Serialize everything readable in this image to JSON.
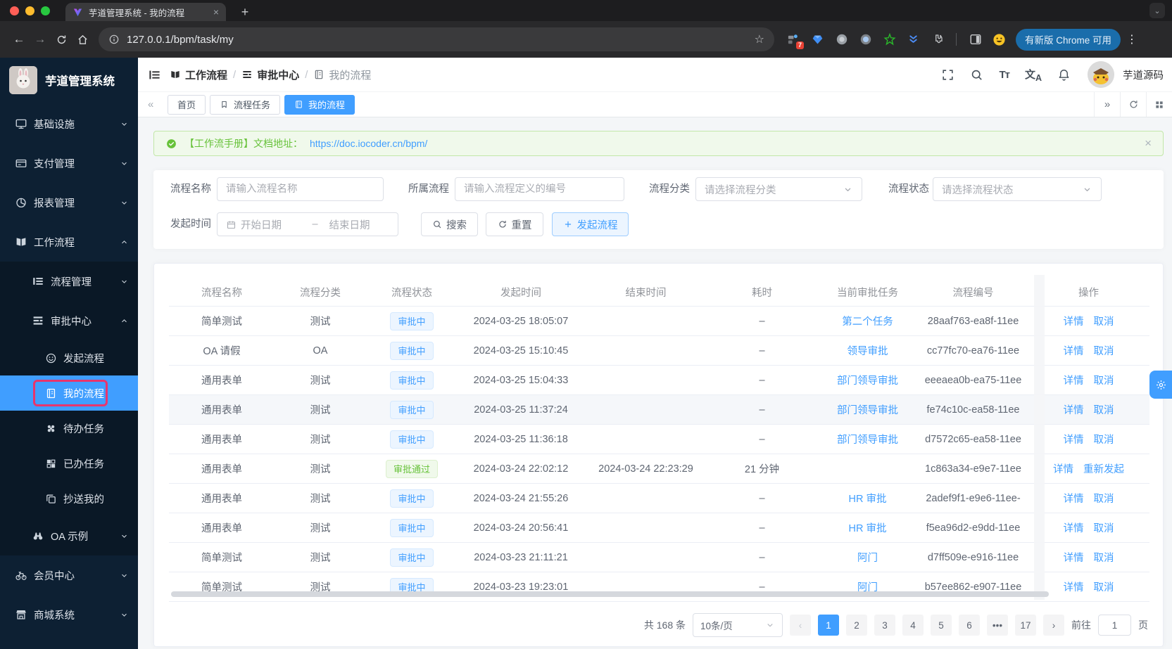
{
  "browser": {
    "tab_title": "芋道管理系统 - 我的流程",
    "url": "127.0.0.1/bpm/task/my",
    "extension_badge": "7",
    "update_chip": "有新版 Chrome 可用"
  },
  "glyphs": {
    "back": "←",
    "forward": "→",
    "new_tab": "+",
    "close": "×",
    "star": "☆",
    "kebab": "⋮",
    "collapse": "«",
    "expand": "»",
    "prev": "‹",
    "next": "›",
    "ellipsis": "•••",
    "dash": "–",
    "tab_search": "⌄"
  },
  "sidebar": {
    "logo_title": "芋道管理系统",
    "items": [
      {
        "label": "基础设施",
        "icon": "monitor-icon",
        "level": 1,
        "chevron": "down"
      },
      {
        "label": "支付管理",
        "icon": "payment-icon",
        "level": 1,
        "chevron": "down"
      },
      {
        "label": "报表管理",
        "icon": "pie-chart-icon",
        "level": 1,
        "chevron": "down"
      },
      {
        "label": "工作流程",
        "icon": "workflow-icon",
        "level": 1,
        "chevron": "up"
      },
      {
        "label": "流程管理",
        "icon": "process-manage-icon",
        "level": 2,
        "chevron": "down",
        "in_submenu": true
      },
      {
        "label": "审批中心",
        "icon": "approval-center-icon",
        "level": 2,
        "chevron": "up",
        "in_submenu": true
      },
      {
        "label": "发起流程",
        "icon": "smiley-icon",
        "level": 3,
        "in_submenu": true
      },
      {
        "label": "我的流程",
        "icon": "notebook-icon",
        "level": 3,
        "in_submenu": true,
        "active": true,
        "annotated": true
      },
      {
        "label": "待办任务",
        "icon": "puzzle-icon",
        "level": 3,
        "in_submenu": true
      },
      {
        "label": "已办任务",
        "icon": "grid-icon",
        "level": 3,
        "in_submenu": true
      },
      {
        "label": "抄送我的",
        "icon": "copy-icon",
        "level": 3,
        "in_submenu": true
      },
      {
        "label": "OA 示例",
        "icon": "binoculars-icon",
        "level": 2,
        "chevron": "down",
        "in_submenu": true
      },
      {
        "label": "会员中心",
        "icon": "bicycle-icon",
        "level": 1,
        "chevron": "down"
      },
      {
        "label": "商城系统",
        "icon": "shop-icon",
        "level": 1,
        "chevron": "down"
      }
    ]
  },
  "header": {
    "breadcrumb": [
      {
        "label": "工作流程",
        "icon": "workflow-icon"
      },
      {
        "label": "审批中心",
        "icon": "approval-center-icon"
      },
      {
        "label": "我的流程",
        "icon": "notebook-icon"
      }
    ],
    "user_name": "芋道源码"
  },
  "tabs": [
    {
      "label": "首页"
    },
    {
      "label": "流程任务",
      "icon": "bookmark-icon"
    },
    {
      "label": "我的流程",
      "icon": "notebook-icon",
      "active": true
    }
  ],
  "alert": {
    "text": "【工作流手册】文档地址：",
    "link": "https://doc.iocoder.cn/bpm/"
  },
  "filter": {
    "name_label": "流程名称",
    "name_placeholder": "请输入流程名称",
    "definition_label": "所属流程",
    "definition_placeholder": "请输入流程定义的编号",
    "category_label": "流程分类",
    "category_placeholder": "请选择流程分类",
    "status_label": "流程状态",
    "status_placeholder": "请选择流程状态",
    "time_label": "发起时间",
    "start_placeholder": "开始日期",
    "separator": "–",
    "end_placeholder": "结束日期",
    "search_button": "搜索",
    "reset_button": "重置",
    "create_button": "发起流程"
  },
  "table": {
    "columns": [
      "流程名称",
      "流程分类",
      "流程状态",
      "发起时间",
      "结束时间",
      "耗时",
      "当前审批任务",
      "流程编号",
      "操作"
    ],
    "highlighted_row_index": 3,
    "rows": [
      {
        "name": "简单测试",
        "category": "测试",
        "status": "审批中",
        "status_type": "processing",
        "start_time": "2024-03-25 18:05:07",
        "end_time": "",
        "duration": "–",
        "current_task": "第二个任务",
        "id": "28aaf763-ea8f-11ee",
        "actions": [
          "详情",
          "取消"
        ]
      },
      {
        "name": "OA 请假",
        "category": "OA",
        "status": "审批中",
        "status_type": "processing",
        "start_time": "2024-03-25 15:10:45",
        "end_time": "",
        "duration": "–",
        "current_task": "领导审批",
        "id": "cc77fc70-ea76-11ee",
        "actions": [
          "详情",
          "取消"
        ]
      },
      {
        "name": "通用表单",
        "category": "测试",
        "status": "审批中",
        "status_type": "processing",
        "start_time": "2024-03-25 15:04:33",
        "end_time": "",
        "duration": "–",
        "current_task": "部门领导审批",
        "id": "eeeaea0b-ea75-11ee",
        "actions": [
          "详情",
          "取消"
        ]
      },
      {
        "name": "通用表单",
        "category": "测试",
        "status": "审批中",
        "status_type": "processing",
        "start_time": "2024-03-25 11:37:24",
        "end_time": "",
        "duration": "–",
        "current_task": "部门领导审批",
        "id": "fe74c10c-ea58-11ee",
        "actions": [
          "详情",
          "取消"
        ]
      },
      {
        "name": "通用表单",
        "category": "测试",
        "status": "审批中",
        "status_type": "processing",
        "start_time": "2024-03-25 11:36:18",
        "end_time": "",
        "duration": "–",
        "current_task": "部门领导审批",
        "id": "d7572c65-ea58-11ee",
        "actions": [
          "详情",
          "取消"
        ]
      },
      {
        "name": "通用表单",
        "category": "测试",
        "status": "审批通过",
        "status_type": "success",
        "start_time": "2024-03-24 22:02:12",
        "end_time": "2024-03-24 22:23:29",
        "duration": "21 分钟",
        "current_task": "",
        "id": "1c863a34-e9e7-11ee",
        "actions": [
          "详情",
          "重新发起"
        ]
      },
      {
        "name": "通用表单",
        "category": "测试",
        "status": "审批中",
        "status_type": "processing",
        "start_time": "2024-03-24 21:55:26",
        "end_time": "",
        "duration": "–",
        "current_task": "HR 审批",
        "id": "2adef9f1-e9e6-11ee-",
        "actions": [
          "详情",
          "取消"
        ]
      },
      {
        "name": "通用表单",
        "category": "测试",
        "status": "审批中",
        "status_type": "processing",
        "start_time": "2024-03-24 20:56:41",
        "end_time": "",
        "duration": "–",
        "current_task": "HR 审批",
        "id": "f5ea96d2-e9dd-11ee",
        "actions": [
          "详情",
          "取消"
        ]
      },
      {
        "name": "简单测试",
        "category": "测试",
        "status": "审批中",
        "status_type": "processing",
        "start_time": "2024-03-23 21:11:21",
        "end_time": "",
        "duration": "–",
        "current_task": "阿门",
        "id": "d7ff509e-e916-11ee",
        "actions": [
          "详情",
          "取消"
        ]
      },
      {
        "name": "简单测试",
        "category": "测试",
        "status": "审批中",
        "status_type": "processing",
        "start_time": "2024-03-23 19:23:01",
        "end_time": "",
        "duration": "–",
        "current_task": "阿门",
        "id": "b57ee862-e907-11ee",
        "actions": [
          "详情",
          "取消"
        ]
      }
    ]
  },
  "pagination": {
    "total_text": "共 168 条",
    "page_size": "10条/页",
    "pages": [
      "1",
      "2",
      "3",
      "4",
      "5",
      "6",
      "•••",
      "17"
    ],
    "active_page": "1",
    "goto_label": "前往",
    "goto_value": "1",
    "goto_suffix": "页"
  },
  "colors": {
    "accent": "#409eff",
    "success": "#67c23a",
    "annotation": "#e8356d",
    "sidebar_bg": "#0d2033"
  }
}
